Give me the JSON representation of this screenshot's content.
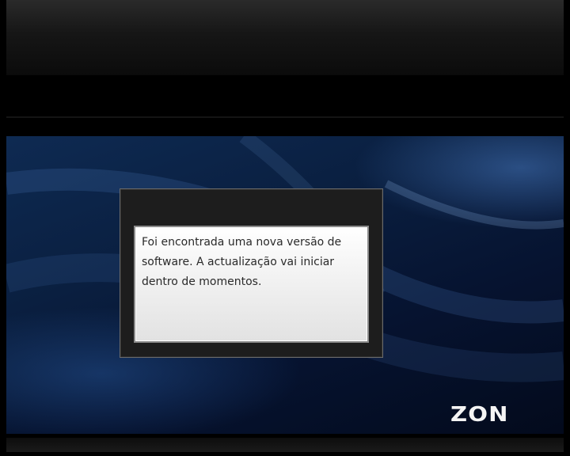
{
  "dialog": {
    "message": "Foi encontrada uma nova versão de software. A actualização vai iniciar dentro de momentos."
  },
  "brand": {
    "logo_text": "ZON"
  },
  "colors": {
    "background_blue": "#0a1f40",
    "dialog_frame": "#1d1d1d",
    "message_box": "#f3f3f3"
  }
}
